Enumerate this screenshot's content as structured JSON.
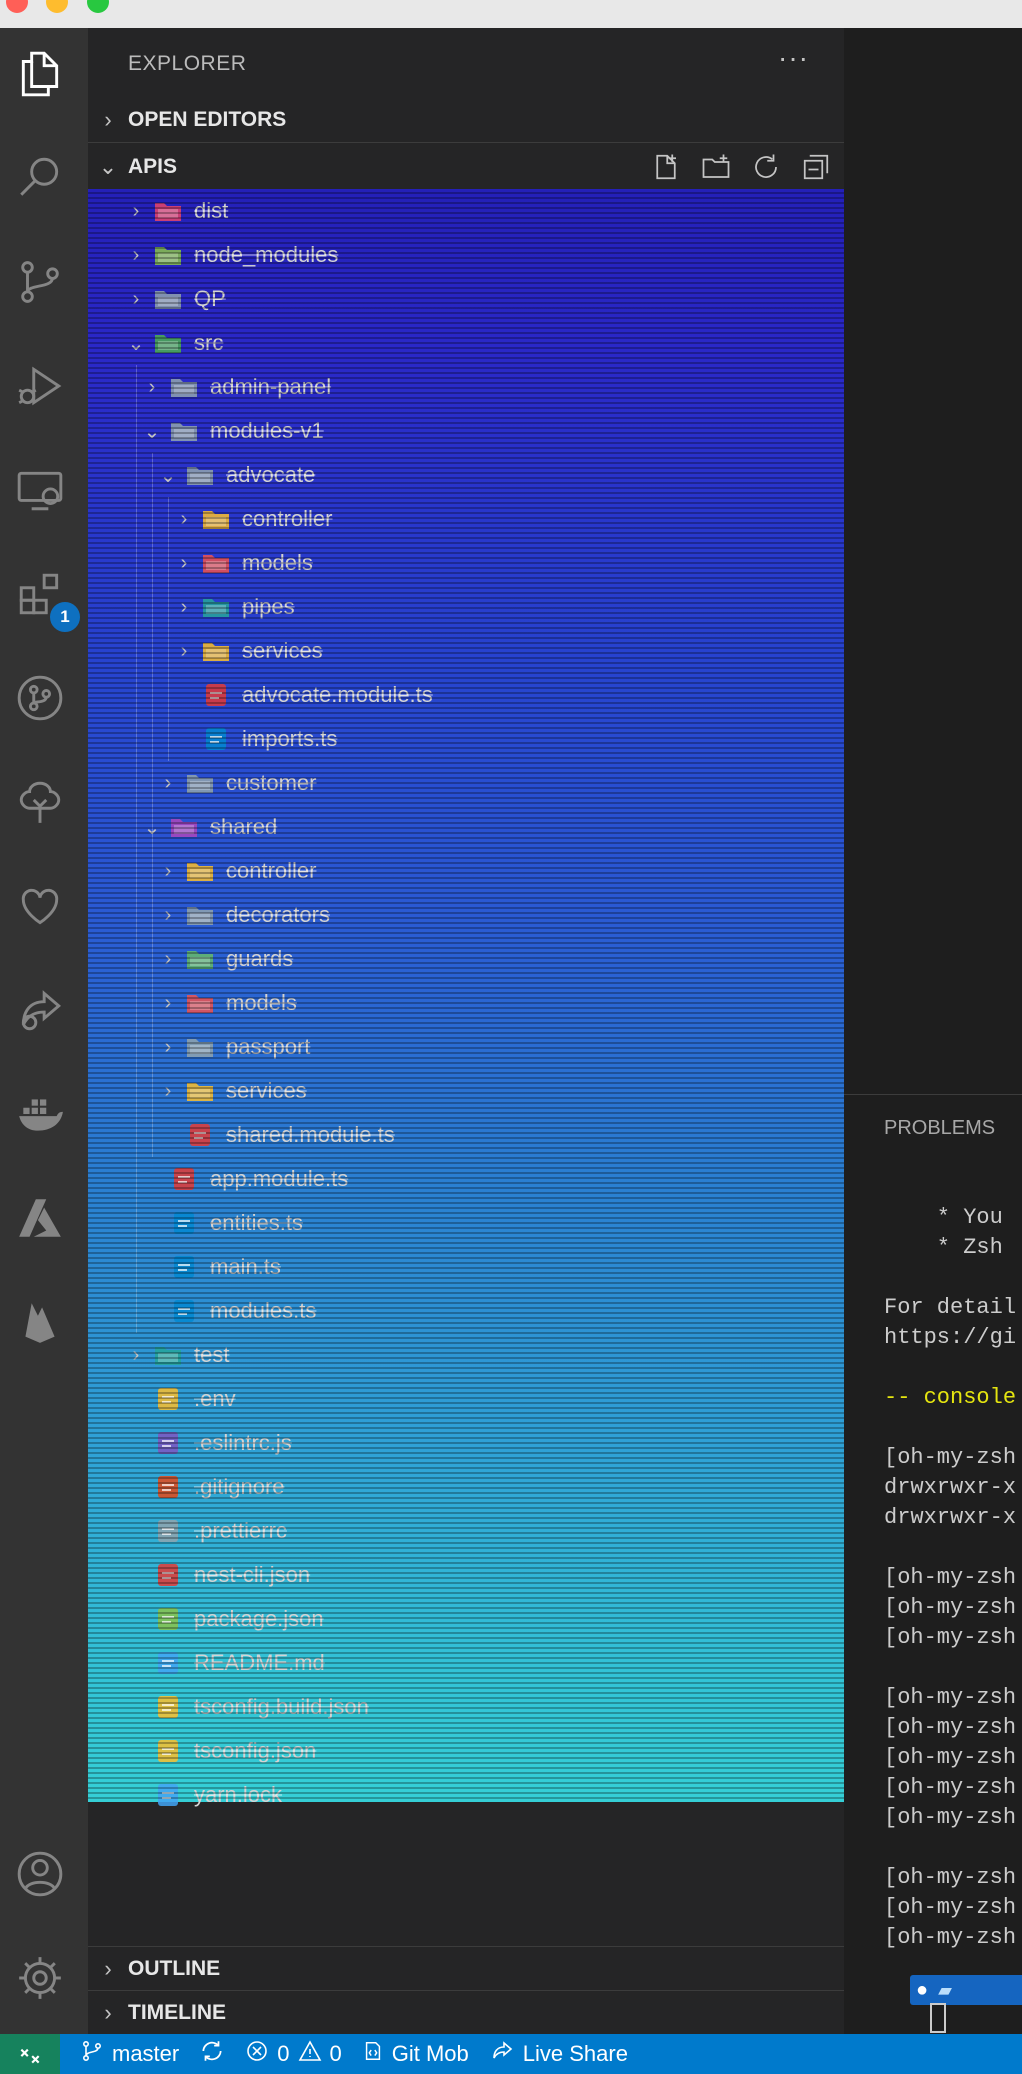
{
  "window": {
    "traffic_lights": [
      "#ff5f57",
      "#febc2e",
      "#28c840"
    ]
  },
  "activity_bar": {
    "items": [
      {
        "name": "files-icon"
      },
      {
        "name": "search-icon"
      },
      {
        "name": "source-control-icon"
      },
      {
        "name": "run-debug-icon"
      },
      {
        "name": "remote-explorer-icon"
      },
      {
        "name": "extensions-icon",
        "badge": "1"
      },
      {
        "name": "git-graph-icon"
      },
      {
        "name": "tree-icon"
      },
      {
        "name": "heart-icon"
      },
      {
        "name": "live-share-icon"
      },
      {
        "name": "docker-icon"
      },
      {
        "name": "azure-icon"
      },
      {
        "name": "firebase-icon"
      }
    ],
    "bottom": [
      {
        "name": "account-icon"
      },
      {
        "name": "settings-gear-icon"
      }
    ]
  },
  "sidebar": {
    "title": "EXPLORER",
    "more": "···",
    "open_editors": "OPEN EDITORS",
    "folder": "APIS",
    "outline": "OUTLINE",
    "timeline": "TIMELINE"
  },
  "tree": [
    {
      "label": "dist",
      "depth": 0,
      "twisty": "›",
      "icon": "folder",
      "color": "#e8446a"
    },
    {
      "label": "node_modules",
      "depth": 0,
      "twisty": "›",
      "icon": "folder",
      "color": "#8bc34a"
    },
    {
      "label": "QP",
      "depth": 0,
      "twisty": "›",
      "icon": "folder",
      "color": "#90a4ae"
    },
    {
      "label": "src",
      "depth": 0,
      "twisty": "⌄",
      "icon": "folder",
      "color": "#4caf50"
    },
    {
      "label": "admin-panel",
      "depth": 1,
      "twisty": "›",
      "icon": "folder",
      "color": "#90a4ae"
    },
    {
      "label": "modules-v1",
      "depth": 1,
      "twisty": "⌄",
      "icon": "folder",
      "color": "#90a4ae"
    },
    {
      "label": "advocate",
      "depth": 2,
      "twisty": "⌄",
      "icon": "folder",
      "color": "#90a4ae"
    },
    {
      "label": "controller",
      "depth": 3,
      "twisty": "›",
      "icon": "folder",
      "color": "#fbc02d"
    },
    {
      "label": "models",
      "depth": 3,
      "twisty": "›",
      "icon": "folder",
      "color": "#ef5350"
    },
    {
      "label": "pipes",
      "depth": 3,
      "twisty": "›",
      "icon": "folder",
      "color": "#26a69a"
    },
    {
      "label": "services",
      "depth": 3,
      "twisty": "›",
      "icon": "folder",
      "color": "#fbc02d"
    },
    {
      "label": "advocate.module.ts",
      "depth": 3,
      "twisty": "",
      "icon": "file",
      "color": "#e53935"
    },
    {
      "label": "imports.ts",
      "depth": 3,
      "twisty": "",
      "icon": "file",
      "color": "#0288d1"
    },
    {
      "label": "customer",
      "depth": 2,
      "twisty": "›",
      "icon": "folder",
      "color": "#90a4ae"
    },
    {
      "label": "shared",
      "depth": 1,
      "twisty": "⌄",
      "icon": "folder",
      "color": "#ab47bc"
    },
    {
      "label": "controller",
      "depth": 2,
      "twisty": "›",
      "icon": "folder",
      "color": "#fbc02d"
    },
    {
      "label": "decorators",
      "depth": 2,
      "twisty": "›",
      "icon": "folder",
      "color": "#90a4ae"
    },
    {
      "label": "guards",
      "depth": 2,
      "twisty": "›",
      "icon": "folder",
      "color": "#66bb6a"
    },
    {
      "label": "models",
      "depth": 2,
      "twisty": "›",
      "icon": "folder",
      "color": "#ef5350"
    },
    {
      "label": "passport",
      "depth": 2,
      "twisty": "›",
      "icon": "folder",
      "color": "#90a4ae"
    },
    {
      "label": "services",
      "depth": 2,
      "twisty": "›",
      "icon": "folder",
      "color": "#fbc02d"
    },
    {
      "label": "shared.module.ts",
      "depth": 2,
      "twisty": "",
      "icon": "file",
      "color": "#e53935"
    },
    {
      "label": "app.module.ts",
      "depth": 1,
      "twisty": "",
      "icon": "file",
      "color": "#e53935"
    },
    {
      "label": "entities.ts",
      "depth": 1,
      "twisty": "",
      "icon": "file",
      "color": "#0288d1"
    },
    {
      "label": "main.ts",
      "depth": 1,
      "twisty": "",
      "icon": "file",
      "color": "#0288d1"
    },
    {
      "label": "modules.ts",
      "depth": 1,
      "twisty": "",
      "icon": "file",
      "color": "#0288d1"
    },
    {
      "label": "test",
      "depth": 0,
      "twisty": "›",
      "icon": "folder",
      "color": "#26a69a"
    },
    {
      "label": ".env",
      "depth": 0,
      "twisty": "",
      "icon": "file",
      "color": "#fbc02d"
    },
    {
      "label": ".eslintrc.js",
      "depth": 0,
      "twisty": "",
      "icon": "file",
      "color": "#7e57c2"
    },
    {
      "label": ".gitignore",
      "depth": 0,
      "twisty": "",
      "icon": "file",
      "color": "#e64a19"
    },
    {
      "label": ".prettierrc",
      "depth": 0,
      "twisty": "",
      "icon": "file",
      "color": "#90a4ae"
    },
    {
      "label": "nest-cli.json",
      "depth": 0,
      "twisty": "",
      "icon": "file",
      "color": "#e53935"
    },
    {
      "label": "package.json",
      "depth": 0,
      "twisty": "",
      "icon": "file",
      "color": "#8bc34a"
    },
    {
      "label": "README.md",
      "depth": 0,
      "twisty": "",
      "icon": "file",
      "color": "#42a5f5"
    },
    {
      "label": "tsconfig.build.json",
      "depth": 0,
      "twisty": "",
      "icon": "file",
      "color": "#fbc02d"
    },
    {
      "label": "tsconfig.json",
      "depth": 0,
      "twisty": "",
      "icon": "file",
      "color": "#fbc02d"
    },
    {
      "label": "yarn.lock",
      "depth": 0,
      "twisty": "",
      "icon": "file",
      "color": "#42a5f5"
    }
  ],
  "panel": {
    "tab": "PROBLEMS",
    "lines": [
      {
        "text": "    * You",
        "color": "#cccccc"
      },
      {
        "text": "    * Zsh",
        "color": "#cccccc"
      },
      {
        "text": "",
        "color": "#cccccc"
      },
      {
        "text": "For detail",
        "color": "#cccccc"
      },
      {
        "text": "https://gi",
        "color": "#cccccc"
      },
      {
        "text": "",
        "color": "#cccccc"
      },
      {
        "text": "-- console",
        "color": "#e5e510"
      },
      {
        "text": "",
        "color": "#cccccc"
      },
      {
        "text": "[oh-my-zsh",
        "color": "#cccccc"
      },
      {
        "text": "drwxrwxr-x",
        "color": "#cccccc"
      },
      {
        "text": "drwxrwxr-x",
        "color": "#cccccc"
      },
      {
        "text": "",
        "color": "#cccccc"
      },
      {
        "text": "[oh-my-zsh",
        "color": "#cccccc"
      },
      {
        "text": "[oh-my-zsh",
        "color": "#cccccc"
      },
      {
        "text": "[oh-my-zsh",
        "color": "#cccccc"
      },
      {
        "text": "",
        "color": "#cccccc"
      },
      {
        "text": "[oh-my-zsh",
        "color": "#cccccc"
      },
      {
        "text": "[oh-my-zsh",
        "color": "#cccccc"
      },
      {
        "text": "[oh-my-zsh",
        "color": "#cccccc"
      },
      {
        "text": "[oh-my-zsh",
        "color": "#cccccc"
      },
      {
        "text": "[oh-my-zsh",
        "color": "#cccccc"
      },
      {
        "text": "",
        "color": "#cccccc"
      },
      {
        "text": "[oh-my-zsh",
        "color": "#cccccc"
      },
      {
        "text": "[oh-my-zsh",
        "color": "#cccccc"
      },
      {
        "text": "[oh-my-zsh",
        "color": "#cccccc"
      }
    ]
  },
  "statusbar": {
    "branch": "master",
    "errors": "0",
    "warnings": "0",
    "git_mob": "Git Mob",
    "live_share": "Live Share"
  }
}
